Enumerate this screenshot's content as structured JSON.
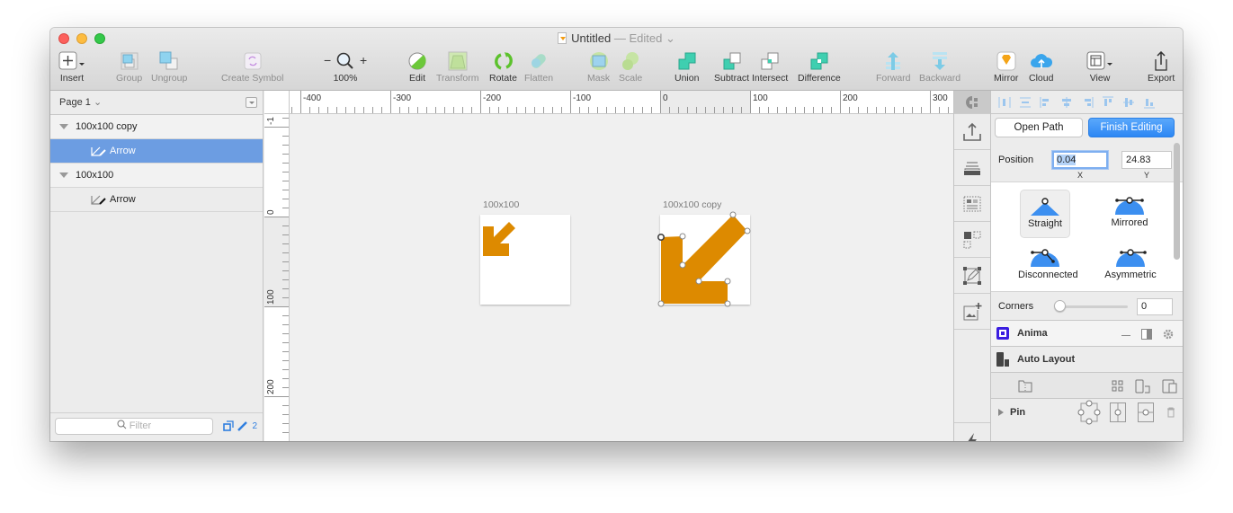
{
  "window": {
    "title": "Untitled",
    "title_separator": " — ",
    "status": "Edited",
    "chevron": "⌄"
  },
  "toolbar": {
    "insert": "Insert",
    "group": "Group",
    "ungroup": "Ungroup",
    "create_symbol": "Create Symbol",
    "zoom_out": "−",
    "zoom_in": "+",
    "zoom_level": "100%",
    "edit": "Edit",
    "transform": "Transform",
    "rotate": "Rotate",
    "flatten": "Flatten",
    "mask": "Mask",
    "scale": "Scale",
    "union": "Union",
    "subtract": "Subtract",
    "intersect": "Intersect",
    "difference": "Difference",
    "forward": "Forward",
    "backward": "Backward",
    "mirror": "Mirror",
    "cloud": "Cloud",
    "view": "View",
    "export": "Export"
  },
  "layers": {
    "page": "Page 1",
    "page_chevron": "⌄",
    "rows": [
      {
        "label": "100x100 copy",
        "type": "group"
      },
      {
        "label": "Arrow",
        "type": "shape",
        "selected": true
      },
      {
        "label": "100x100",
        "type": "group"
      },
      {
        "label": "Arrow",
        "type": "shape",
        "selected": false
      }
    ],
    "filter_placeholder": "Filter",
    "edited_count": "2"
  },
  "rulers": {
    "horizontal": [
      "-400",
      "-300",
      "-200",
      "-100",
      "0",
      "100",
      "200",
      "300"
    ],
    "vertical": [
      "-1",
      "0",
      "100",
      "200"
    ]
  },
  "canvas": {
    "artboards": [
      {
        "label": "100x100"
      },
      {
        "label": "100x100 copy"
      }
    ],
    "shape_color": "#dd8a00"
  },
  "inspector": {
    "open_path": "Open Path",
    "finish_editing": "Finish Editing",
    "position_label": "Position",
    "x_value": "0.04",
    "y_value": "24.83",
    "x_label": "X",
    "y_label": "Y",
    "point_types": [
      {
        "label": "Straight",
        "active": true
      },
      {
        "label": "Mirrored",
        "active": false
      },
      {
        "label": "Disconnected",
        "active": false
      },
      {
        "label": "Asymmetric",
        "active": false
      }
    ],
    "corners_label": "Corners",
    "corners_value": "0",
    "corners_slider": 0
  },
  "plugins": {
    "anima": "Anima",
    "auto_layout": "Auto Layout",
    "pin": "Pin"
  },
  "colors": {
    "accent": "#2d87f4",
    "selection": "#6c9de2",
    "shape": "#dd8a00",
    "point_icon": "#3c8ff0"
  }
}
